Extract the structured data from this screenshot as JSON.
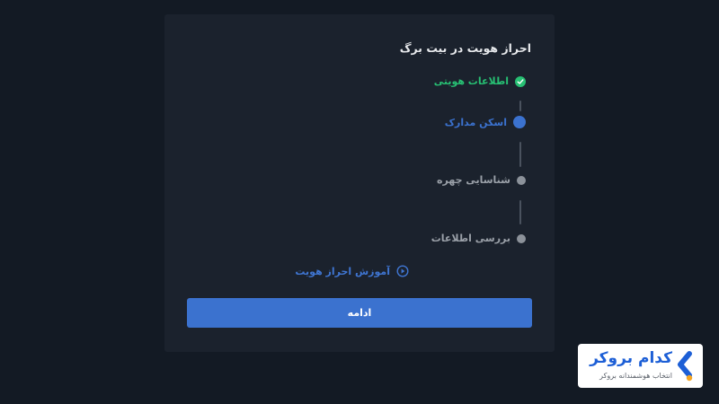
{
  "kyc": {
    "title": "احراز هویت در بیت برگ",
    "steps": [
      {
        "label": "اطلاعات هویتی",
        "status": "completed",
        "color": "#27c073"
      },
      {
        "label": "اسکن مدارک",
        "status": "active",
        "color": "#3b72cf"
      },
      {
        "label": "شناسایی چهره",
        "status": "pending",
        "color": "#9aa0a8"
      },
      {
        "label": "بررسی اطلاعات",
        "status": "pending",
        "color": "#9aa0a8"
      }
    ],
    "tutorial_label": "آموزش احراز هویت",
    "continue_label": "ادامه"
  },
  "branding": {
    "name": "کدام بروکر",
    "tagline": "انتخاب هوشمندانه بروکر",
    "accent": "#1d5fd6",
    "dot_color": "#f5a623"
  },
  "icons": {
    "step_done": "check-circle-icon",
    "tutorial": "play-circle-icon"
  }
}
